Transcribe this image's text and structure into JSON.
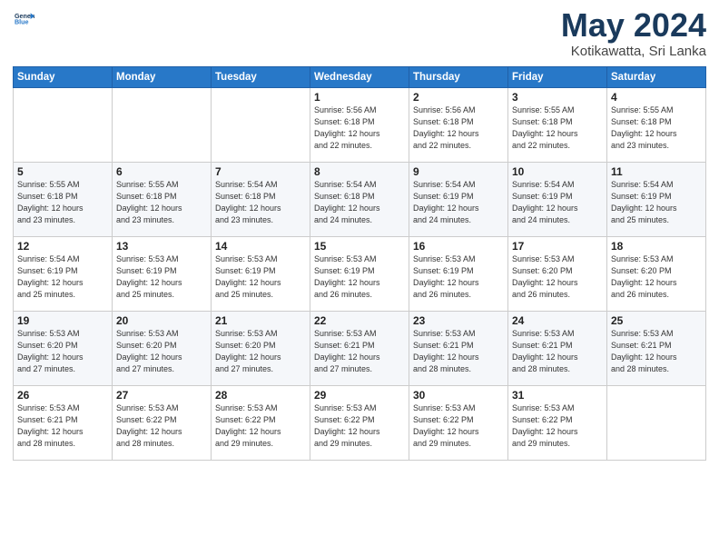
{
  "logo": {
    "line1": "General",
    "line2": "Blue",
    "icon": "▶"
  },
  "title": "May 2024",
  "location": "Kotikawatta, Sri Lanka",
  "headers": [
    "Sunday",
    "Monday",
    "Tuesday",
    "Wednesday",
    "Thursday",
    "Friday",
    "Saturday"
  ],
  "weeks": [
    [
      {
        "day": "",
        "info": ""
      },
      {
        "day": "",
        "info": ""
      },
      {
        "day": "",
        "info": ""
      },
      {
        "day": "1",
        "info": "Sunrise: 5:56 AM\nSunset: 6:18 PM\nDaylight: 12 hours\nand 22 minutes."
      },
      {
        "day": "2",
        "info": "Sunrise: 5:56 AM\nSunset: 6:18 PM\nDaylight: 12 hours\nand 22 minutes."
      },
      {
        "day": "3",
        "info": "Sunrise: 5:55 AM\nSunset: 6:18 PM\nDaylight: 12 hours\nand 22 minutes."
      },
      {
        "day": "4",
        "info": "Sunrise: 5:55 AM\nSunset: 6:18 PM\nDaylight: 12 hours\nand 23 minutes."
      }
    ],
    [
      {
        "day": "5",
        "info": "Sunrise: 5:55 AM\nSunset: 6:18 PM\nDaylight: 12 hours\nand 23 minutes."
      },
      {
        "day": "6",
        "info": "Sunrise: 5:55 AM\nSunset: 6:18 PM\nDaylight: 12 hours\nand 23 minutes."
      },
      {
        "day": "7",
        "info": "Sunrise: 5:54 AM\nSunset: 6:18 PM\nDaylight: 12 hours\nand 23 minutes."
      },
      {
        "day": "8",
        "info": "Sunrise: 5:54 AM\nSunset: 6:18 PM\nDaylight: 12 hours\nand 24 minutes."
      },
      {
        "day": "9",
        "info": "Sunrise: 5:54 AM\nSunset: 6:19 PM\nDaylight: 12 hours\nand 24 minutes."
      },
      {
        "day": "10",
        "info": "Sunrise: 5:54 AM\nSunset: 6:19 PM\nDaylight: 12 hours\nand 24 minutes."
      },
      {
        "day": "11",
        "info": "Sunrise: 5:54 AM\nSunset: 6:19 PM\nDaylight: 12 hours\nand 25 minutes."
      }
    ],
    [
      {
        "day": "12",
        "info": "Sunrise: 5:54 AM\nSunset: 6:19 PM\nDaylight: 12 hours\nand 25 minutes."
      },
      {
        "day": "13",
        "info": "Sunrise: 5:53 AM\nSunset: 6:19 PM\nDaylight: 12 hours\nand 25 minutes."
      },
      {
        "day": "14",
        "info": "Sunrise: 5:53 AM\nSunset: 6:19 PM\nDaylight: 12 hours\nand 25 minutes."
      },
      {
        "day": "15",
        "info": "Sunrise: 5:53 AM\nSunset: 6:19 PM\nDaylight: 12 hours\nand 26 minutes."
      },
      {
        "day": "16",
        "info": "Sunrise: 5:53 AM\nSunset: 6:19 PM\nDaylight: 12 hours\nand 26 minutes."
      },
      {
        "day": "17",
        "info": "Sunrise: 5:53 AM\nSunset: 6:20 PM\nDaylight: 12 hours\nand 26 minutes."
      },
      {
        "day": "18",
        "info": "Sunrise: 5:53 AM\nSunset: 6:20 PM\nDaylight: 12 hours\nand 26 minutes."
      }
    ],
    [
      {
        "day": "19",
        "info": "Sunrise: 5:53 AM\nSunset: 6:20 PM\nDaylight: 12 hours\nand 27 minutes."
      },
      {
        "day": "20",
        "info": "Sunrise: 5:53 AM\nSunset: 6:20 PM\nDaylight: 12 hours\nand 27 minutes."
      },
      {
        "day": "21",
        "info": "Sunrise: 5:53 AM\nSunset: 6:20 PM\nDaylight: 12 hours\nand 27 minutes."
      },
      {
        "day": "22",
        "info": "Sunrise: 5:53 AM\nSunset: 6:21 PM\nDaylight: 12 hours\nand 27 minutes."
      },
      {
        "day": "23",
        "info": "Sunrise: 5:53 AM\nSunset: 6:21 PM\nDaylight: 12 hours\nand 28 minutes."
      },
      {
        "day": "24",
        "info": "Sunrise: 5:53 AM\nSunset: 6:21 PM\nDaylight: 12 hours\nand 28 minutes."
      },
      {
        "day": "25",
        "info": "Sunrise: 5:53 AM\nSunset: 6:21 PM\nDaylight: 12 hours\nand 28 minutes."
      }
    ],
    [
      {
        "day": "26",
        "info": "Sunrise: 5:53 AM\nSunset: 6:21 PM\nDaylight: 12 hours\nand 28 minutes."
      },
      {
        "day": "27",
        "info": "Sunrise: 5:53 AM\nSunset: 6:22 PM\nDaylight: 12 hours\nand 28 minutes."
      },
      {
        "day": "28",
        "info": "Sunrise: 5:53 AM\nSunset: 6:22 PM\nDaylight: 12 hours\nand 29 minutes."
      },
      {
        "day": "29",
        "info": "Sunrise: 5:53 AM\nSunset: 6:22 PM\nDaylight: 12 hours\nand 29 minutes."
      },
      {
        "day": "30",
        "info": "Sunrise: 5:53 AM\nSunset: 6:22 PM\nDaylight: 12 hours\nand 29 minutes."
      },
      {
        "day": "31",
        "info": "Sunrise: 5:53 AM\nSunset: 6:22 PM\nDaylight: 12 hours\nand 29 minutes."
      },
      {
        "day": "",
        "info": ""
      }
    ]
  ]
}
